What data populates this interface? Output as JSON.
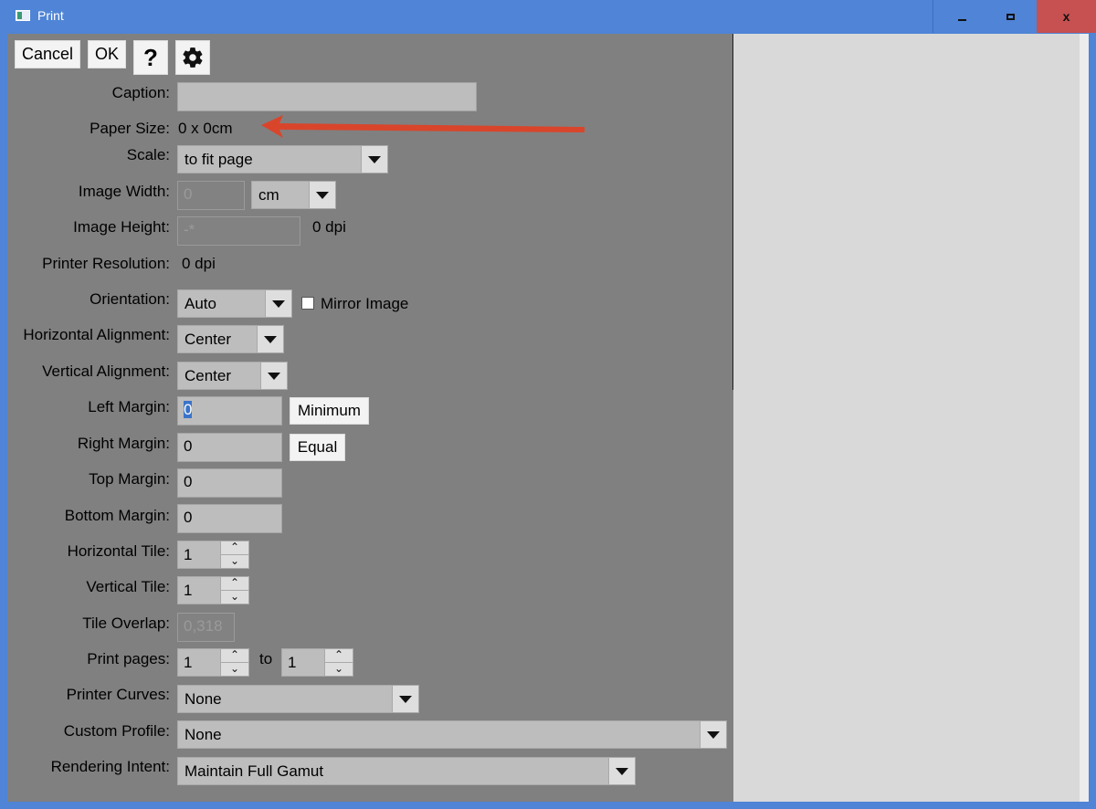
{
  "window": {
    "title": "Print"
  },
  "toolbar": {
    "cancel_label": "Cancel",
    "ok_label": "OK",
    "help_glyph": "?",
    "settings_icon": "gear-icon"
  },
  "form": {
    "caption": {
      "label": "Caption:",
      "value": ""
    },
    "paper_size": {
      "label": "Paper Size:",
      "value": "0 x 0cm"
    },
    "scale": {
      "label": "Scale:",
      "value": "to fit page"
    },
    "image_width": {
      "label": "Image Width:",
      "value": "0",
      "unit": "cm"
    },
    "image_height": {
      "label": "Image Height:",
      "value": "-*",
      "dpi": "0 dpi"
    },
    "printer_resolution": {
      "label": "Printer Resolution:",
      "value": "0 dpi"
    },
    "orientation": {
      "label": "Orientation:",
      "value": "Auto",
      "mirror_label": "Mirror Image",
      "mirror_checked": false
    },
    "horizontal_alignment": {
      "label": "Horizontal Alignment:",
      "value": "Center"
    },
    "vertical_alignment": {
      "label": "Vertical Alignment:",
      "value": "Center"
    },
    "left_margin": {
      "label": "Left Margin:",
      "value": "0",
      "button": "Minimum"
    },
    "right_margin": {
      "label": "Right Margin:",
      "value": "0",
      "button": "Equal"
    },
    "top_margin": {
      "label": "Top Margin:",
      "value": "0"
    },
    "bottom_margin": {
      "label": "Bottom Margin:",
      "value": "0"
    },
    "horizontal_tile": {
      "label": "Horizontal Tile:",
      "value": "1"
    },
    "vertical_tile": {
      "label": "Vertical Tile:",
      "value": "1"
    },
    "tile_overlap": {
      "label": "Tile Overlap:",
      "value": "0,318"
    },
    "print_pages": {
      "label": "Print pages:",
      "from": "1",
      "to_label": "to",
      "to": "1"
    },
    "printer_curves": {
      "label": "Printer Curves:",
      "value": "None"
    },
    "custom_profile": {
      "label": "Custom Profile:",
      "value": "None"
    },
    "rendering_intent": {
      "label": "Rendering Intent:",
      "value": "Maintain Full Gamut"
    }
  },
  "colors": {
    "titlebar": "#4f84d6",
    "close_button": "#c75050",
    "panel": "#808080",
    "preview": "#d9d9d9",
    "annotation_arrow": "#d9452b"
  }
}
